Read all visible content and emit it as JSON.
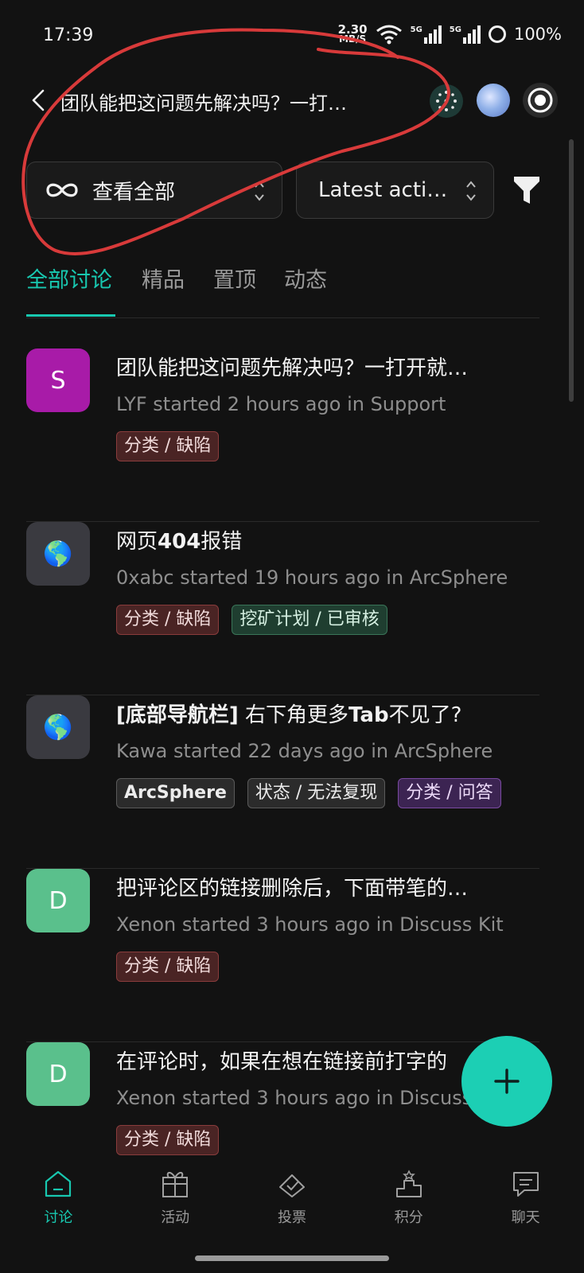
{
  "status_bar": {
    "time": "17:39",
    "net_speed_value": "2.30",
    "net_speed_unit": "MB/S",
    "signal_1": "5G",
    "signal_2": "5G",
    "battery": "100%"
  },
  "header": {
    "title": "团队能把这问题先解决吗？一打…"
  },
  "filters": {
    "scope_label": "查看全部",
    "sort_label": "Latest acti…"
  },
  "tabs": [
    {
      "label": "全部讨论",
      "active": true
    },
    {
      "label": "精品"
    },
    {
      "label": "置顶"
    },
    {
      "label": "动态"
    }
  ],
  "discussions": [
    {
      "avatar_text": "S",
      "avatar_color": "#a81ba8",
      "title": "团队能把这问题先解决吗？一打开就…",
      "meta": "LYF started 2 hours ago in Support",
      "tags": [
        {
          "label": "分类 / 缺陷",
          "style": "red"
        }
      ]
    },
    {
      "avatar_text": "🌎",
      "avatar_color": "#3a3a40",
      "title_prefix": "网页",
      "title_bold": "404",
      "title_suffix": "报错",
      "meta": "0xabc started 19 hours ago in ArcSphere",
      "tags": [
        {
          "label": "分类 / 缺陷",
          "style": "red"
        },
        {
          "label": "挖矿计划 / 已审核",
          "style": "green"
        }
      ]
    },
    {
      "avatar_text": "🌎",
      "avatar_color": "#3a3a40",
      "title_bold_prefix": "[底部导航栏]",
      "title_mid": " 右下角更多",
      "title_bold": "Tab",
      "title_suffix": "不见了?",
      "meta": "Kawa started 22 days ago in ArcSphere",
      "tags": [
        {
          "label": "ArcSphere",
          "style": "gray"
        },
        {
          "label": "状态 / 无法复现",
          "style": "gray"
        },
        {
          "label": "分类 / 问答",
          "style": "purple"
        }
      ]
    },
    {
      "avatar_text": "D",
      "avatar_color": "#5ac08c",
      "title": "把评论区的链接删除后，下面带笔的…",
      "meta": "Xenon started 3 hours ago in Discuss Kit",
      "tags": [
        {
          "label": "分类 / 缺陷",
          "style": "red"
        }
      ]
    },
    {
      "avatar_text": "D",
      "avatar_color": "#5ac08c",
      "title": "在评论时，如果在想在链接前打字的",
      "meta": "Xenon started 3 hours ago in Discuss",
      "tags": [
        {
          "label": "分类 / 缺陷",
          "style": "red"
        }
      ]
    }
  ],
  "bottom_nav": [
    {
      "label": "讨论",
      "icon": "home-icon",
      "active": true
    },
    {
      "label": "活动",
      "icon": "gift-icon"
    },
    {
      "label": "投票",
      "icon": "vote-icon"
    },
    {
      "label": "积分",
      "icon": "podium-icon"
    },
    {
      "label": "聊天",
      "icon": "chat-icon"
    }
  ],
  "colors": {
    "accent": "#18c8b0",
    "fab": "#1ccfb4",
    "annotation": "#d83a3a"
  }
}
